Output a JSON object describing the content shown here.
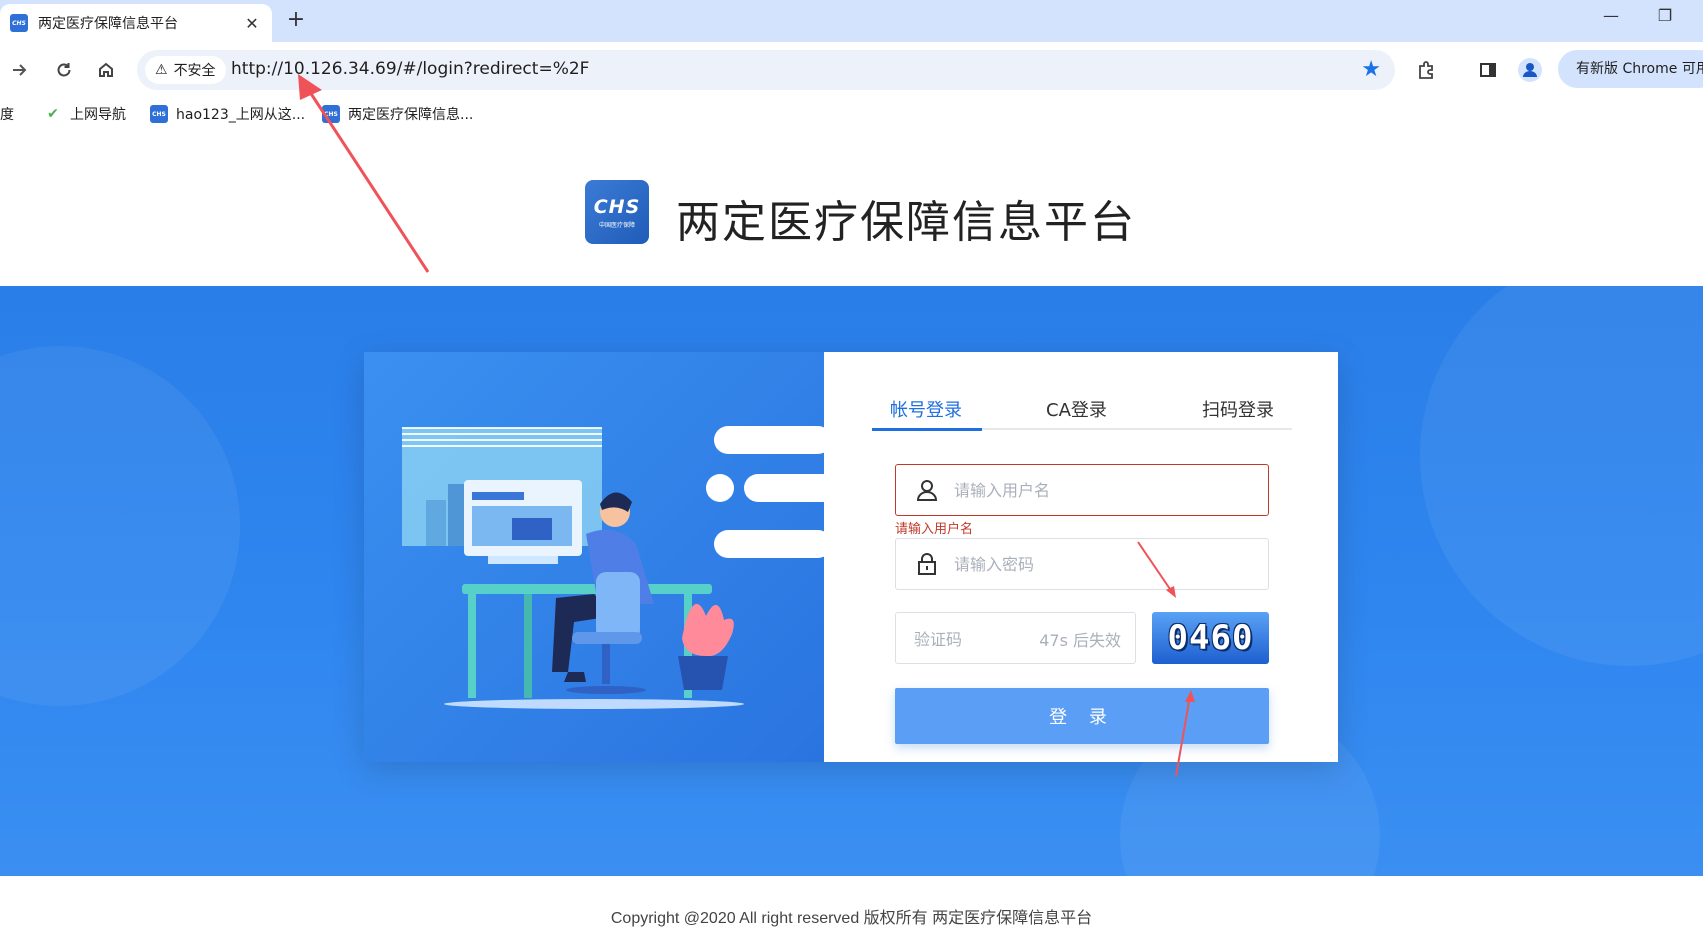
{
  "browser": {
    "tab_title": "两定医疗保障信息平台",
    "tab_favicon": "CHS",
    "close": "✕",
    "new_tab": "+",
    "minimize": "—",
    "restore": "❐",
    "security_label": "不安全",
    "url": "http://10.126.34.69/#/login?redirect=%2F",
    "update_button": "有新版 Chrome 可用",
    "bookmarks": [
      {
        "label": "百度"
      },
      {
        "label": "上网导航"
      },
      {
        "label": "hao123_上网从这..."
      },
      {
        "label": "两定医疗保障信息..."
      }
    ]
  },
  "header": {
    "logo_text": "CHS",
    "logo_subtext": "中国医疗保障",
    "title": "两定医疗保障信息平台"
  },
  "login": {
    "tabs": [
      {
        "label": "帐号登录",
        "active": true
      },
      {
        "label": "CA登录",
        "active": false
      },
      {
        "label": "扫码登录",
        "active": false
      }
    ],
    "username_placeholder": "请输入用户名",
    "username_error": "请输入用户名",
    "password_placeholder": "请输入密码",
    "captcha_placeholder": "验证码",
    "captcha_countdown": "47s 后失效",
    "captcha_code": "0460",
    "submit_label": "登 录"
  },
  "footer": {
    "copyright": "Copyright @2020 All right reserved 版权所有 两定医疗保障信息平台"
  },
  "colors": {
    "brand_blue": "#2a7ee8",
    "active_tab": "#1f6fe0",
    "error_red": "#c0392b",
    "button_blue": "#5b9ef5",
    "annotation_red": "#f0525a"
  }
}
